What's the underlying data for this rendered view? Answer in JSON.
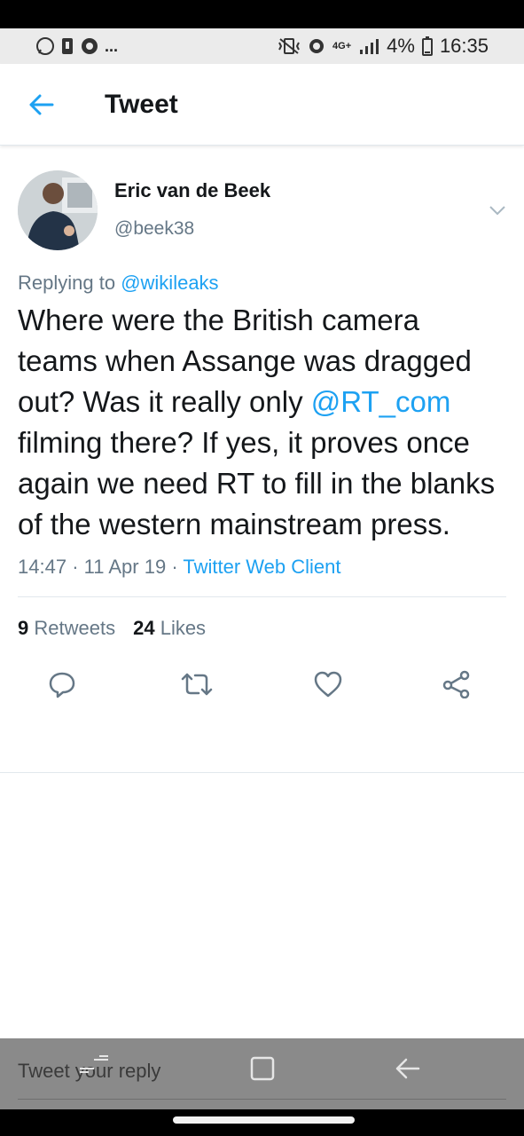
{
  "status_bar": {
    "notification_dots": "...",
    "network": "4G+",
    "battery": "4%",
    "time": "16:35"
  },
  "header": {
    "title": "Tweet"
  },
  "tweet": {
    "author": {
      "display_name": "Eric van de Beek",
      "handle": "@beek38"
    },
    "replying_prefix": "Replying to",
    "replying_to": "@wikileaks",
    "text_before_mention": "Where were the British camera teams when Assange was dragged out? Was it really only",
    "mention": "@RT_com",
    "text_after_mention": " filming there? If yes, it proves once again we need RT to fill in the blanks of the western mainstream press.",
    "time": "14:47",
    "date": "11 Apr 19",
    "source": "Twitter Web Client",
    "meta_separator": "·",
    "retweets_count": "9",
    "retweets_label": "Retweets",
    "likes_count": "24",
    "likes_label": "Likes"
  },
  "compose": {
    "placeholder": "Tweet your reply"
  },
  "icons": {
    "back": "arrow-left-icon",
    "caret": "chevron-down-icon",
    "reply": "reply-icon",
    "retweet": "retweet-icon",
    "like": "heart-icon",
    "share": "share-icon"
  },
  "colors": {
    "accent": "#1da1f2",
    "text": "#14171a",
    "secondary": "#657786"
  }
}
